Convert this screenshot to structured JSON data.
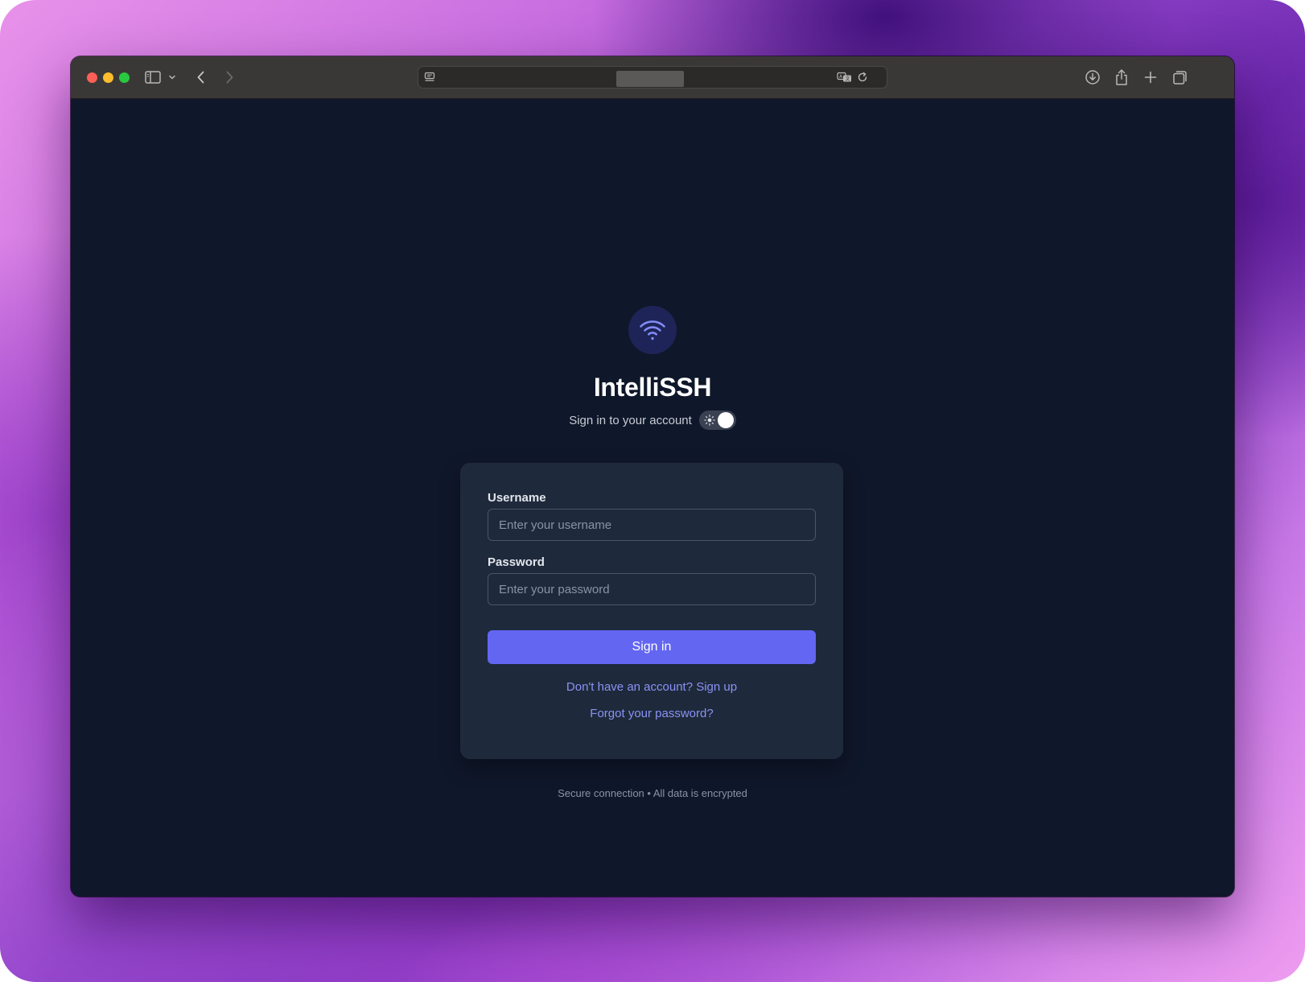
{
  "browser": {
    "back_icon": "chevron-left-icon",
    "forward_icon": "chevron-right-icon",
    "sidebar_icon": "sidebar-icon",
    "address_url": "",
    "toolbar_icons": [
      "download-icon",
      "share-icon",
      "new-tab-icon",
      "tabs-overview-icon"
    ]
  },
  "app": {
    "title": "IntelliSSH",
    "subtitle": "Sign in to your account",
    "logo_icon": "wifi-icon",
    "theme_toggle_icon": "sun-icon",
    "theme_toggle_on": true
  },
  "form": {
    "username_label": "Username",
    "username_placeholder": "Enter your username",
    "username_value": "",
    "password_label": "Password",
    "password_placeholder": "Enter your password",
    "password_value": "",
    "submit_label": "Sign in",
    "signup_link": "Don't have an account? Sign up",
    "forgot_link": "Forgot your password?"
  },
  "footer": {
    "note": "Secure connection • All data is encrypted"
  },
  "colors": {
    "page_bg": "#0f172a",
    "card_bg": "#1e293b",
    "accent": "#6366f1",
    "link": "#8b93f5",
    "logo_bg": "#1e2457"
  }
}
